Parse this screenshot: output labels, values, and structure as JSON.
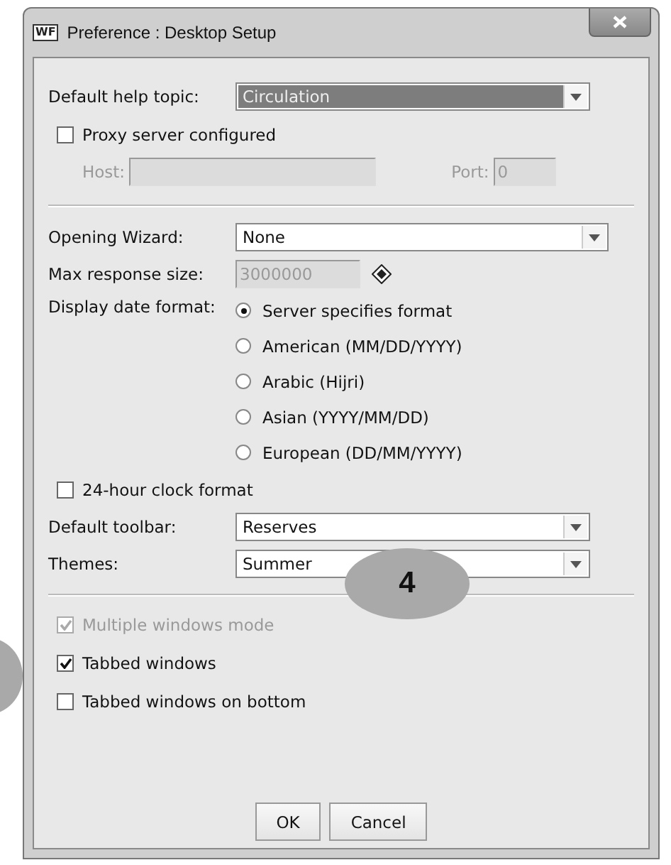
{
  "window": {
    "title": "Preference : Desktop Setup",
    "icon": "WF"
  },
  "help_topic": {
    "label": "Default help topic:",
    "value": "Circulation",
    "selected": true
  },
  "proxy": {
    "label": "Proxy server configured",
    "checked": false
  },
  "host": {
    "label": "Host:",
    "disabled": true
  },
  "port": {
    "label": "Port:",
    "value": "0",
    "disabled": true
  },
  "opening_wizard": {
    "label": "Opening Wizard:",
    "value": "None"
  },
  "max_response": {
    "label": "Max response size:",
    "value": "3000000",
    "disabled": true
  },
  "date_format": {
    "label": "Display date format:",
    "options": [
      {
        "label": "Server specifies format",
        "selected": true
      },
      {
        "label": "American (MM/DD/YYYY)",
        "selected": false
      },
      {
        "label": "Arabic (Hijri)",
        "selected": false
      },
      {
        "label": "Asian (YYYY/MM/DD)",
        "selected": false
      },
      {
        "label": "European (DD/MM/YYYY)",
        "selected": false
      }
    ]
  },
  "clock_24h": {
    "label": "24-hour clock format",
    "checked": false
  },
  "default_toolbar": {
    "label": "Default toolbar:",
    "value": "Reserves"
  },
  "themes": {
    "label": "Themes:",
    "value": "Summer"
  },
  "window_options": [
    {
      "label": "Multiple windows mode",
      "checked": true,
      "disabled": true
    },
    {
      "label": "Tabbed windows",
      "checked": true,
      "disabled": false
    },
    {
      "label": "Tabbed windows on bottom",
      "checked": false,
      "disabled": false
    }
  ],
  "buttons": [
    "OK",
    "Cancel"
  ],
  "callout": {
    "label": "4"
  }
}
